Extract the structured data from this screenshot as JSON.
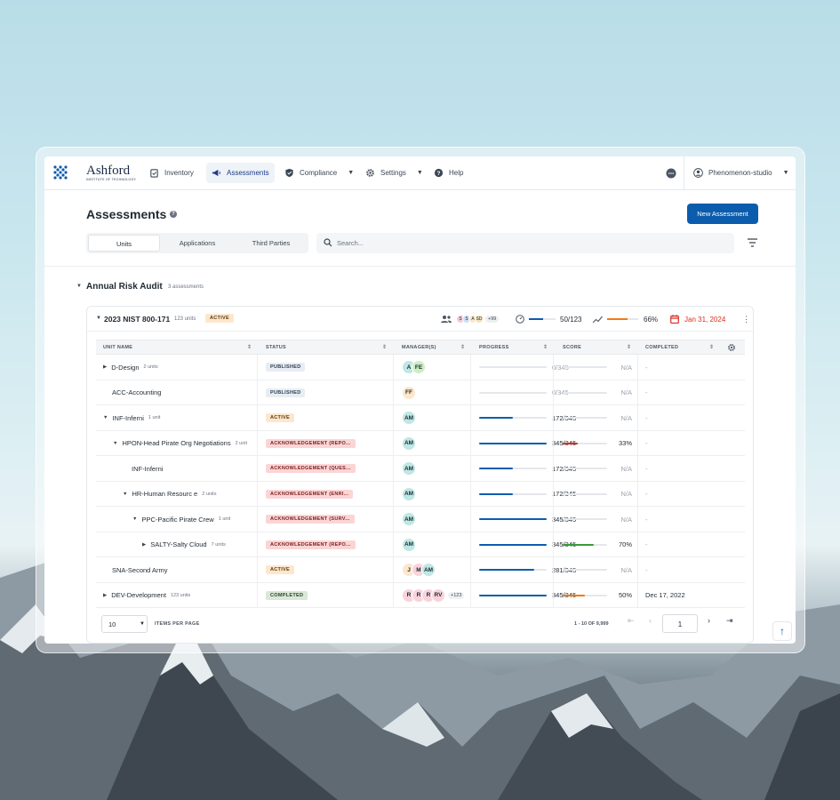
{
  "app": {
    "logo_name": "Ashford",
    "logo_sub": "INSTITUTE OF TECHNOLOGY",
    "brand_color": "#0b5cad"
  },
  "nav": {
    "items": [
      {
        "label": "Inventory",
        "icon": "clipboard-icon"
      },
      {
        "label": "Assessments",
        "icon": "megaphone-icon"
      },
      {
        "label": "Compliance",
        "icon": "shield-icon"
      },
      {
        "label": "Settings",
        "icon": "gear-icon"
      },
      {
        "label": "Help",
        "icon": "help-icon"
      }
    ],
    "user": "Phenomenon-studio"
  },
  "header": {
    "title": "Assessments",
    "new_button": "New Assessment"
  },
  "tabs": [
    "Units",
    "Applications",
    "Third Parties"
  ],
  "search": {
    "placeholder": "Search..."
  },
  "group": {
    "title": "Annual Risk Audit",
    "count": "3 assessments"
  },
  "assessment": {
    "title": "2023 NIST 800-171",
    "units": "123 units",
    "status": "ACTIVE",
    "managers": [
      "S",
      "S",
      "A",
      "SD"
    ],
    "managers_more": "+99",
    "progress": "50/123",
    "score": "66%",
    "due": "Jan 31, 2024"
  },
  "table": {
    "columns": [
      "UNIT NAME",
      "STATUS",
      "MANAGER(S)",
      "PROGRESS",
      "SCORE",
      "COMPLETED"
    ],
    "rows": [
      {
        "name": "D-Design",
        "sub": "2 units",
        "status": "PUBLISHED",
        "stype": "pub",
        "managers": [
          "A",
          "FE"
        ],
        "progress": "0/345",
        "pfrac": 0,
        "score": "N/A",
        "sfrac": 0,
        "scolor": "",
        "completed": "-"
      },
      {
        "name": "ACC-Accounting",
        "sub": "",
        "status": "PUBLISHED",
        "stype": "pub",
        "managers": [
          "FF"
        ],
        "progress": "0/345",
        "pfrac": 0,
        "score": "N/A",
        "sfrac": 0,
        "scolor": "",
        "completed": "-"
      },
      {
        "name": "INF-Inferni",
        "sub": "1 unit",
        "status": "ACTIVE",
        "stype": "active",
        "managers": [
          "AM"
        ],
        "progress": "172/345",
        "pfrac": 0.5,
        "score": "N/A",
        "sfrac": 0,
        "scolor": "",
        "completed": "-"
      },
      {
        "name": "HPON-Head Pirate Org Negotiations",
        "sub": "2 unit",
        "status": "ACKNOWLEDGEMENT (REPO...",
        "stype": "ack",
        "managers": [
          "AM"
        ],
        "progress": "345/345",
        "pfrac": 1,
        "score": "33%",
        "sfrac": 0.33,
        "scolor": "#d92d20",
        "completed": "-"
      },
      {
        "name": "INF-Inferni",
        "sub": "",
        "status": "ACKNOWLEDGEMENT (QUES...",
        "stype": "ack",
        "managers": [
          "AM"
        ],
        "progress": "172/345",
        "pfrac": 0.5,
        "score": "N/A",
        "sfrac": 0,
        "scolor": "",
        "completed": "-"
      },
      {
        "name": "HR-Human Resourc e",
        "sub": "2 units",
        "status": "ACKNOWLEDGEMENT (ENRI...",
        "stype": "ack",
        "managers": [
          "AM"
        ],
        "progress": "172/345",
        "pfrac": 0.5,
        "score": "N/A",
        "sfrac": 0,
        "scolor": "",
        "completed": "-"
      },
      {
        "name": "PPC-Pacific Pirate Crew",
        "sub": "1 unit",
        "status": "ACKNOWLEDGEMENT (SURV...",
        "stype": "ack",
        "managers": [
          "AM"
        ],
        "progress": "345/345",
        "pfrac": 1,
        "score": "N/A",
        "sfrac": 0,
        "scolor": "",
        "completed": "-"
      },
      {
        "name": "SALTY-Salty Cloud",
        "sub": "7 units",
        "status": "ACKNOWLEDGEMENT (REPO...",
        "stype": "ack",
        "managers": [
          "AM"
        ],
        "progress": "345/345",
        "pfrac": 1,
        "score": "70%",
        "sfrac": 0.7,
        "scolor": "#3a9a3a",
        "completed": "-"
      },
      {
        "name": "SNA-Second Army",
        "sub": "",
        "status": "ACTIVE",
        "stype": "active",
        "managers": [
          "J",
          "M",
          "AM"
        ],
        "progress": "281/345",
        "pfrac": 0.81,
        "score": "N/A",
        "sfrac": 0,
        "scolor": "",
        "completed": "-"
      },
      {
        "name": "DEV-Development",
        "sub": "123 units",
        "status": "COMPLETED",
        "stype": "comp",
        "managers": [
          "R",
          "R",
          "R",
          "RV"
        ],
        "managers_more": "+123",
        "progress": "345/345",
        "pfrac": 1,
        "score": "50%",
        "sfrac": 0.5,
        "scolor": "#f07a1a",
        "completed": "Dec 17, 2022"
      }
    ]
  },
  "footer": {
    "per_page": "10",
    "items_label": "ITEMS PER PAGE",
    "range": "1 - 10 OF 9,999",
    "page": "1"
  }
}
